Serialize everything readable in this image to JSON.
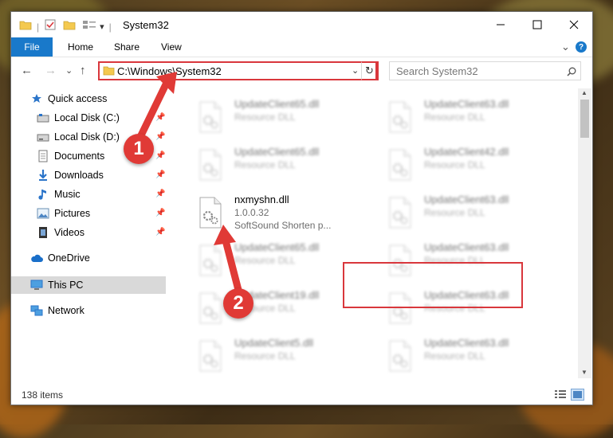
{
  "window": {
    "title": "System32",
    "qa_separator": "|",
    "qa_dropdown": "▾"
  },
  "ribbon": {
    "tabs": [
      "File",
      "Home",
      "Share",
      "View"
    ],
    "help": "?",
    "expand": "⌄"
  },
  "nav": {
    "back": "←",
    "forward": "→",
    "recent": "⌄",
    "up": "↑",
    "address": "C:\\Windows\\System32",
    "address_dropdown": "⌄",
    "refresh": "↻",
    "search_placeholder": "Search System32"
  },
  "sidebar": {
    "items": [
      {
        "label": "Quick access",
        "icon": "star-icon",
        "pinned": false
      },
      {
        "label": "Local Disk (C:)",
        "icon": "drive-icon",
        "pinned": true
      },
      {
        "label": "Local Disk (D:)",
        "icon": "drive-icon",
        "pinned": true
      },
      {
        "label": "Documents",
        "icon": "documents-icon",
        "pinned": true
      },
      {
        "label": "Downloads",
        "icon": "download-icon",
        "pinned": true
      },
      {
        "label": "Music",
        "icon": "music-icon",
        "pinned": true
      },
      {
        "label": "Pictures",
        "icon": "pictures-icon",
        "pinned": true
      },
      {
        "label": "Videos",
        "icon": "videos-icon",
        "pinned": true
      },
      {
        "label": "OneDrive",
        "icon": "cloud-icon",
        "pinned": false
      },
      {
        "label": "This PC",
        "icon": "computer-icon",
        "pinned": false,
        "selected": true
      },
      {
        "label": "Network",
        "icon": "network-icon",
        "pinned": false
      }
    ],
    "pin_glyph": "📌"
  },
  "files": {
    "left": [
      {
        "name": "UpdateClient65.dll",
        "type": "Resource DLL"
      },
      {
        "name": "UpdateClient65.dll",
        "type": "Resource DLL"
      },
      {
        "name": "nxmyshn.dll",
        "version": "1.0.0.32",
        "desc": "SoftSound Shorten p...",
        "highlighted": true
      },
      {
        "name": "UpdateClient65.dll",
        "type": "Resource DLL"
      },
      {
        "name": "UpdateClient19.dll",
        "type": "Resource DLL"
      },
      {
        "name": "UpdateClient5.dll",
        "type": "Resource DLL"
      }
    ],
    "right": [
      {
        "name": "UpdateClient63.dll",
        "type": "Resource DLL"
      },
      {
        "name": "UpdateClient42.dll",
        "type": "Resource DLL"
      },
      {
        "name": "UpdateClient63.dll",
        "type": "Resource DLL"
      },
      {
        "name": "UpdateClient63.dll",
        "type": "Resource DLL"
      },
      {
        "name": "UpdateClient63.dll",
        "type": "Resource DLL"
      },
      {
        "name": "UpdateClient63.dll",
        "type": "Resource DLL"
      }
    ]
  },
  "status": {
    "item_count": "138 items"
  },
  "annotations": {
    "step1": "1",
    "step2": "2",
    "color": "#e03a36"
  },
  "colors": {
    "accent": "#1979ca",
    "highlight_border": "#d9373c",
    "selected_bg": "#d9d9d9"
  }
}
